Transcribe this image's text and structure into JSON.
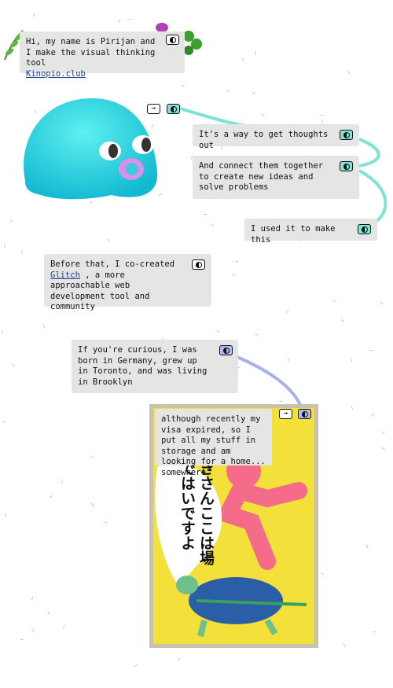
{
  "cards": [
    {
      "text": "Hi, my name is Pirijan and I make the visual thinking tool",
      "link": "Kinopio.club",
      "connector_color": "#ffffff"
    },
    {
      "text": "It's a way to get thoughts out",
      "connector_color": "#7fe3d4"
    },
    {
      "text": "And connect them together to create new ideas and solve problems",
      "connector_color": "#7fe3d4"
    },
    {
      "text": "I used it to make this",
      "connector_color": "#7fe3d4"
    },
    {
      "text_before": "Before that, I co-created ",
      "link": "Glitch",
      "text_after": " , a more approachable web development tool and community",
      "connector_color": "#ffffff"
    },
    {
      "text": "If you're curious, I was born in Germany, grew up in Toronto, and was living in Brooklyn",
      "connector_color": "#b3b8ef"
    },
    {
      "text": "although recently my visa expired, so I put all my stuff in storage and am looking for a home... somewhere",
      "connector_color": "#b3b8ef"
    }
  ],
  "arrow_label": "→",
  "connection_colors": {
    "teal": "#7fe3d4",
    "purple": "#aab0ea"
  },
  "poster": {
    "lettering": "きさんここは場ではいですよ",
    "background": "#f3e03a"
  }
}
